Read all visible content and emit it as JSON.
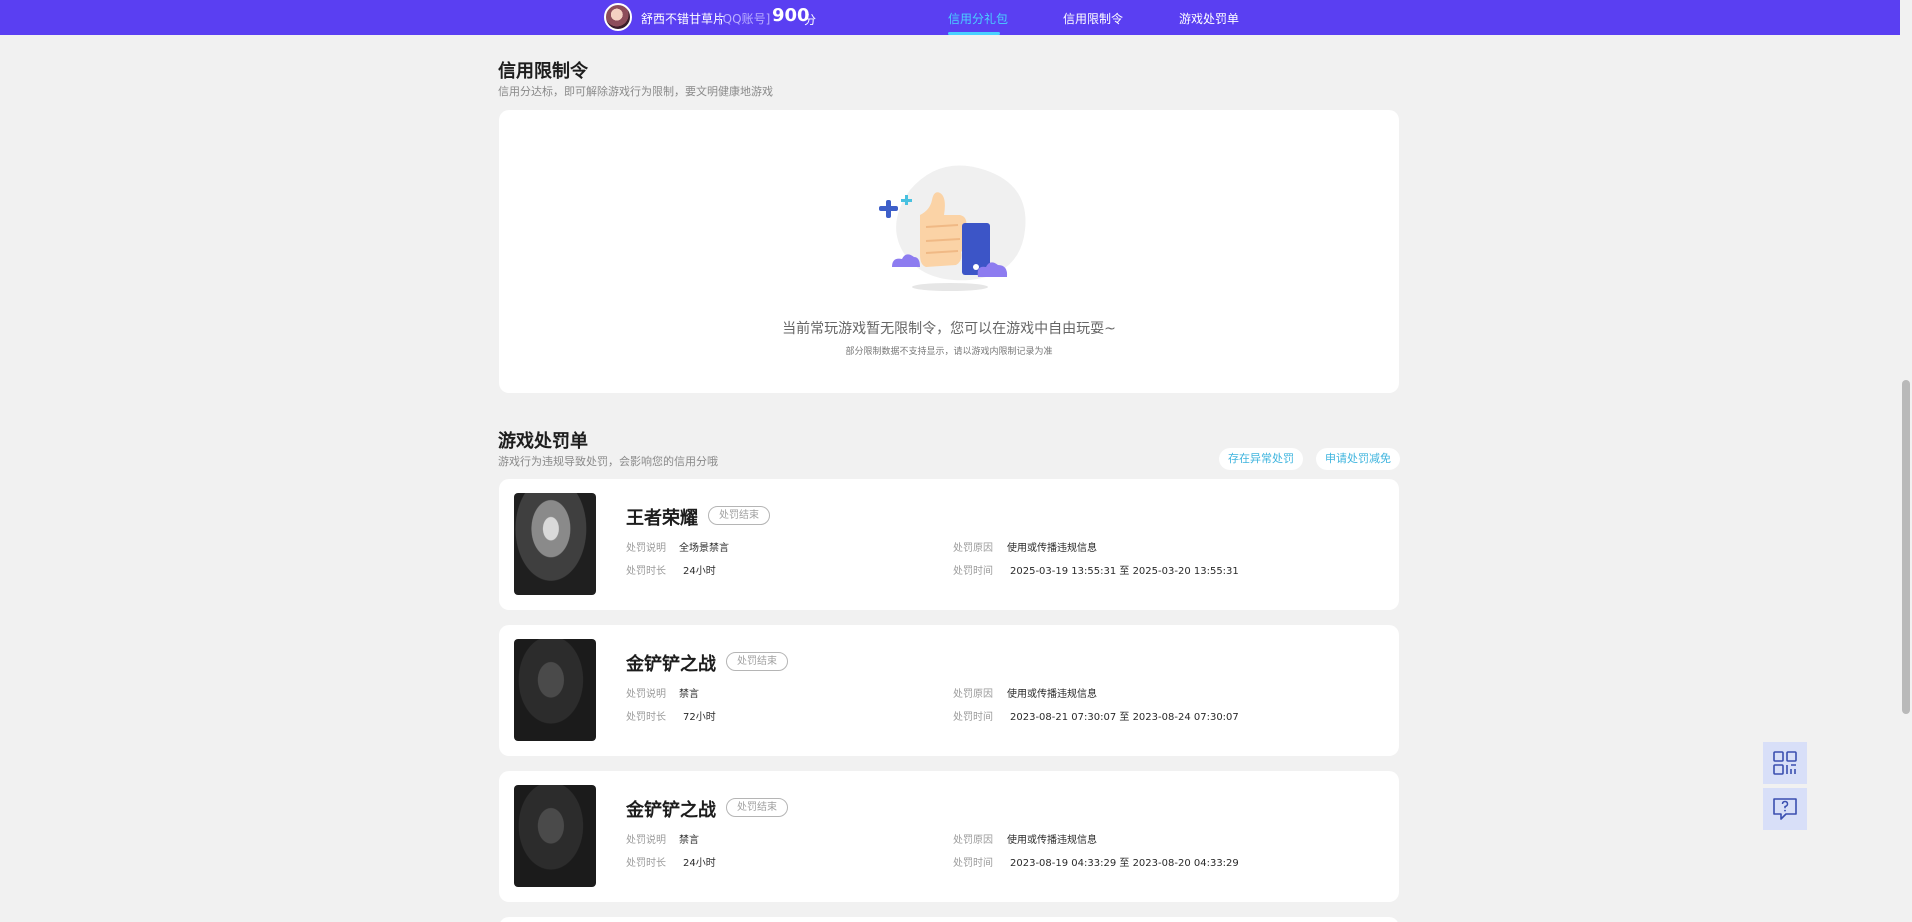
{
  "header": {
    "nickname": "舒西不错甘草片",
    "account_type": "[QQ账号]",
    "score": "900",
    "score_unit": "分",
    "tabs": [
      {
        "label": "信用分礼包",
        "active": true
      },
      {
        "label": "信用限制令",
        "active": false
      },
      {
        "label": "游戏处罚单",
        "active": false
      }
    ],
    "accent_color": "#5a3ff2",
    "active_tab_color": "#49d1ff"
  },
  "restriction": {
    "title": "信用限制令",
    "subtitle": "信用分达标，即可解除游戏行为限制，要文明健康地游戏",
    "empty_message": "当前常玩游戏暂无限制令，您可以在游戏中自由玩耍~",
    "empty_note": "部分限制数据不支持显示，请以游戏内限制记录为准"
  },
  "penalties": {
    "title": "游戏处罚单",
    "subtitle": "游戏行为违规导致处罚，会影响您的信用分哦",
    "actions": [
      "存在异常处罚",
      "申请处罚减免"
    ],
    "field_labels": {
      "desc": "处罚说明",
      "duration": "处罚时长",
      "reason": "处罚原因",
      "time": "处罚时间"
    },
    "items": [
      {
        "game": "王者荣耀",
        "status": "处罚结束",
        "desc": "全场景禁言",
        "duration": "24小时",
        "reason": "使用或传播违规信息",
        "time": "2025-03-19 13:55:31 至 2025-03-20 13:55:31"
      },
      {
        "game": "金铲铲之战",
        "status": "处罚结束",
        "desc": "禁言",
        "duration": "72小时",
        "reason": "使用或传播违规信息",
        "time": "2023-08-21 07:30:07 至 2023-08-24 07:30:07"
      },
      {
        "game": "金铲铲之战",
        "status": "处罚结束",
        "desc": "禁言",
        "duration": "24小时",
        "reason": "使用或传播违规信息",
        "time": "2023-08-19 04:33:29 至 2023-08-20 04:33:29"
      }
    ]
  },
  "floating": {
    "icons": [
      "qr-code-icon",
      "feedback-icon"
    ]
  }
}
